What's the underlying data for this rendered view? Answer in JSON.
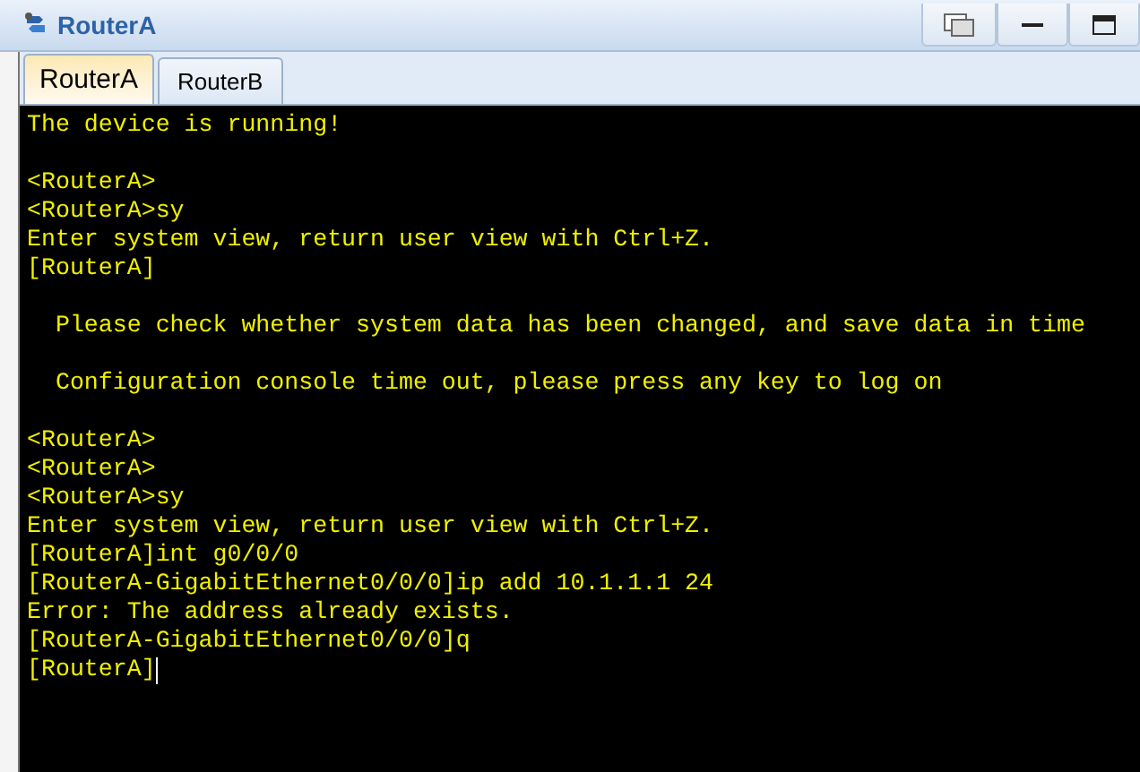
{
  "window": {
    "title": "RouterA"
  },
  "tabs": [
    {
      "label": "RouterA",
      "selected": true
    },
    {
      "label": "RouterB",
      "selected": false
    }
  ],
  "terminal": {
    "blocks": [
      {
        "lines": [
          "The device is running!"
        ]
      },
      {
        "lines": [
          "<RouterA>",
          "<RouterA>sy",
          "Enter system view, return user view with Ctrl+Z.",
          "[RouterA]"
        ]
      },
      {
        "lines": [
          "  Please check whether system data has been changed, and save data in time"
        ]
      },
      {
        "lines": [
          "  Configuration console time out, please press any key to log on"
        ]
      },
      {
        "lines": [
          "<RouterA>",
          "<RouterA>",
          "<RouterA>sy",
          "Enter system view, return user view with Ctrl+Z.",
          "[RouterA]int g0/0/0",
          "[RouterA-GigabitEthernet0/0/0]ip add 10.1.1.1 24",
          "Error: The address already exists.",
          "[RouterA-GigabitEthernet0/0/0]q",
          "[RouterA]"
        ]
      }
    ],
    "cursor_visible": true
  }
}
